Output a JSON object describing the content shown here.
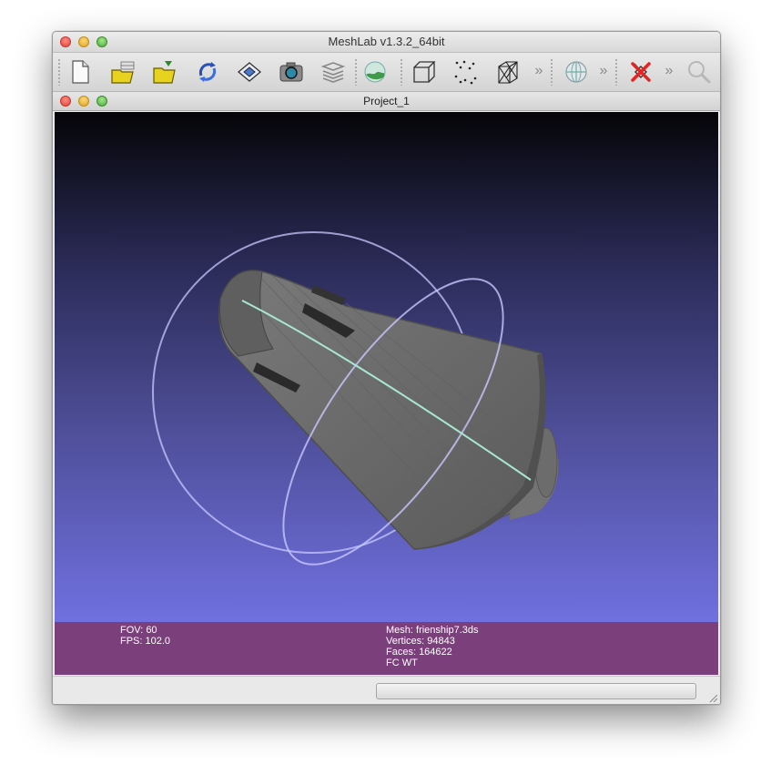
{
  "window": {
    "title": "MeshLab v1.3.2_64bit",
    "subwindow_title": "Project_1"
  },
  "toolbar": {
    "items": [
      {
        "icon": "new-document-icon"
      },
      {
        "icon": "open-project-icon"
      },
      {
        "icon": "open-mesh-icon"
      },
      {
        "icon": "reload-icon"
      },
      {
        "icon": "save-icon"
      },
      {
        "icon": "snapshot-icon"
      },
      {
        "icon": "layers-icon"
      },
      {
        "icon": "globe-icon"
      },
      {
        "icon": "bounding-box-icon"
      },
      {
        "icon": "points-icon"
      },
      {
        "icon": "wireframe-icon"
      },
      {
        "icon": "more-chevron-icon"
      },
      {
        "icon": "trackball-icon"
      },
      {
        "icon": "more-chevron-icon"
      },
      {
        "icon": "delete-x-icon"
      },
      {
        "icon": "more-chevron-icon"
      },
      {
        "icon": "magnifier-icon"
      }
    ],
    "chevron": "»"
  },
  "info": {
    "fov": "FOV: 60",
    "fps": "FPS:   102.0",
    "mesh": "Mesh: frienship7.3ds",
    "vertices": "Vertices: 94843",
    "faces": "Faces: 164622",
    "mode": "FC WT"
  },
  "colors": {
    "info_bg": "#7b3f7b",
    "viewport_top": "#050508",
    "viewport_bottom": "#7070e0",
    "mesh": "#6e6e6e",
    "trackball_ring": "#c8c8ff",
    "trackball_equator": "#a8e8d0"
  },
  "status": {
    "progress": 0
  }
}
